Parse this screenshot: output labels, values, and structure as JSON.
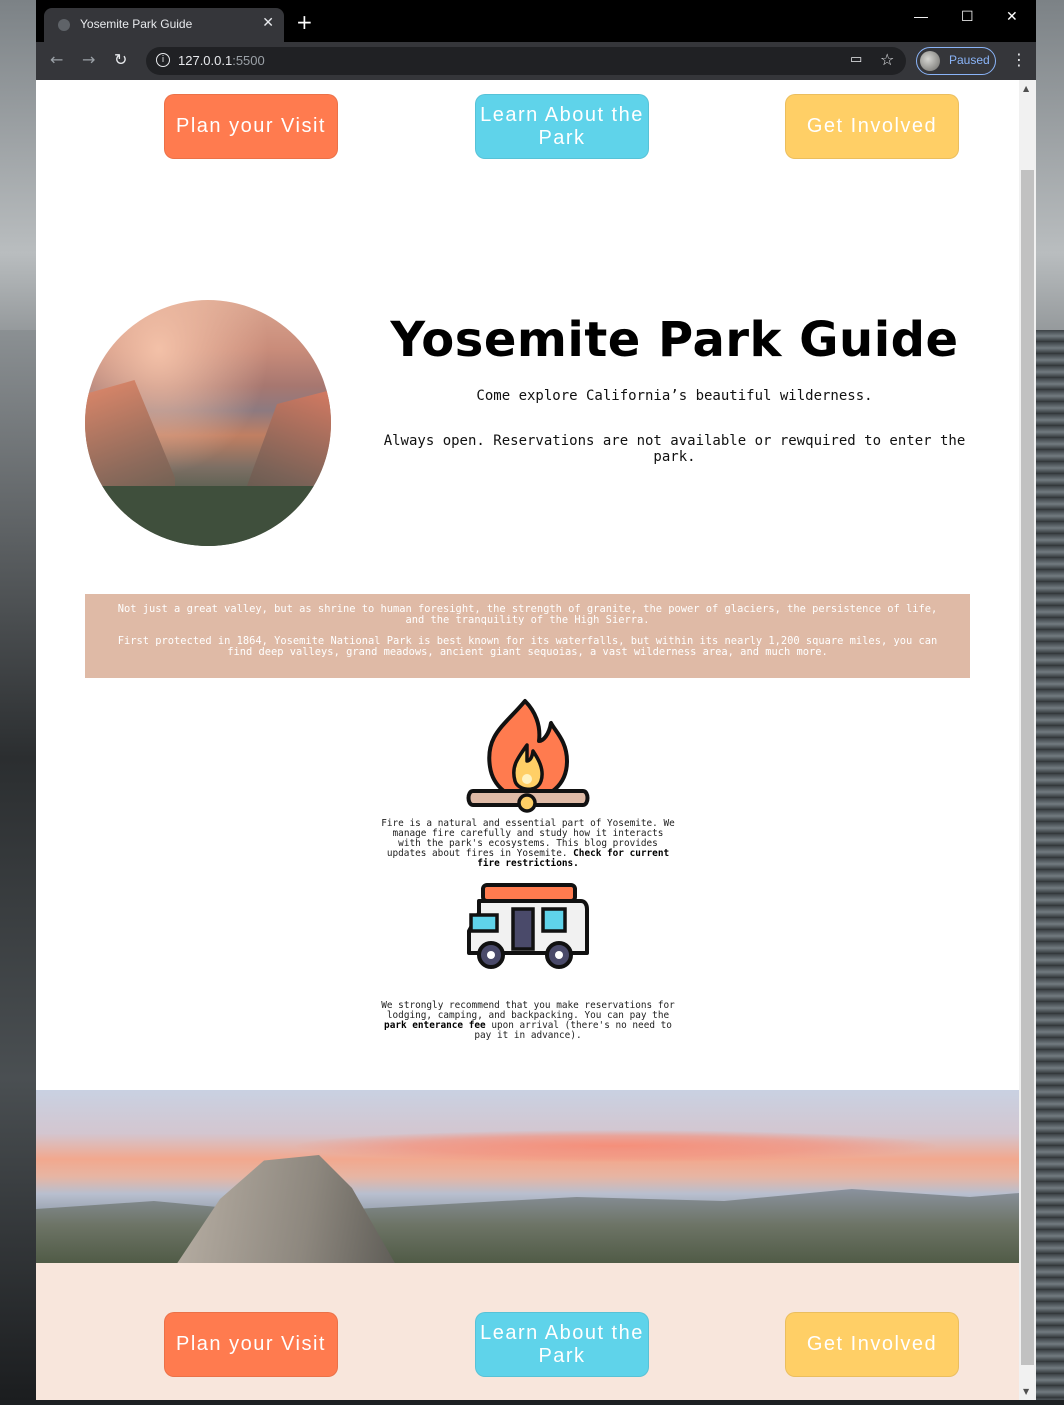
{
  "browser": {
    "tab_title": "Yosemite Park Guide",
    "url_host": "127.0.0.1",
    "url_port": ":5500",
    "profile_label": "Paused"
  },
  "nav": {
    "plan": "Plan your Visit",
    "learn": "Learn About the Park",
    "involved": "Get Involved"
  },
  "hero": {
    "title": "Yosemite Park Guide",
    "subtitle": "Come explore California’s beautiful wilderness.",
    "hours": "Always open. Reservations are not available or rewquired to enter the park."
  },
  "banner": {
    "p1": "Not just a great valley, but as shrine to human foresight, the strength of granite, the power of glaciers, the persistence of life, and the tranquility of the High Sierra.",
    "p2": "First protected in 1864, Yosemite National Park is best known for its waterfalls, but within its nearly 1,200 square miles, you can find deep valleys, grand meadows, ancient giant sequoias, a vast wilderness area, and much more."
  },
  "fire": {
    "text": "Fire is a natural and essential part of Yosemite. We manage fire carefully and study how it interacts with the park's ecosystems. This blog provides updates about fires in Yosemite.",
    "link": "Check for current fire restrictions."
  },
  "camping": {
    "text_before": "We strongly recommend that you make reservations for lodging, camping, and backpacking. You can pay the",
    "link": "park enterance fee",
    "text_after": "upon arrival (there's no need to pay it in advance)."
  },
  "colors": {
    "orange": "#ff7b4f",
    "blue": "#5fd3ea",
    "yellow": "#ffcf66",
    "banner": "#dfbaa6",
    "footer": "#f8e6dc"
  }
}
